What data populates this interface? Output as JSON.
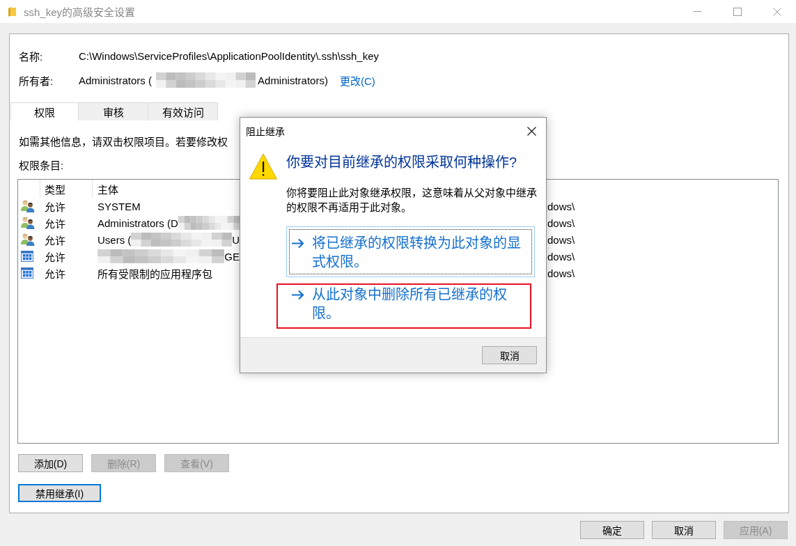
{
  "window": {
    "title": "ssh_key的高级安全设置"
  },
  "name_field": {
    "label": "名称:",
    "value": "C:\\Windows\\ServiceProfiles\\ApplicationPoolIdentity\\.ssh\\ssh_key"
  },
  "owner_field": {
    "label": "所有者:",
    "value": "Administrators (",
    "redacted": true,
    "value_tail": "Administrators)",
    "change_link": "更改(C)"
  },
  "tabs": [
    {
      "label": "权限",
      "selected": true
    },
    {
      "label": "审核",
      "selected": false
    },
    {
      "label": "有效访问",
      "selected": false
    }
  ],
  "info_text": "如需其他信息，请双击权限项目。若要修改权",
  "entries_label": "权限条目:",
  "permission_list": {
    "columns": [
      "类型",
      "主体"
    ],
    "rows": [
      {
        "kind": "group",
        "entry_type": "允许",
        "principal": "SYSTEM",
        "redacted": false,
        "column_3": "dows\\"
      },
      {
        "kind": "group",
        "entry_type": "允许",
        "principal": "Administrators (D",
        "redacted": true,
        "column_3": "dows\\"
      },
      {
        "kind": "group",
        "entry_type": "允许",
        "principal": "Users (",
        "redacted": true,
        "principal_tail": "U",
        "column_3": "dows\\"
      },
      {
        "kind": "package",
        "entry_type": "允许",
        "redacted": true,
        "principal_tail": "GE",
        "column_3": "dows\\"
      },
      {
        "kind": "package",
        "entry_type": "允许",
        "principal": "所有受限制的应用程序包",
        "redacted": false,
        "column_3": "dows\\"
      }
    ]
  },
  "list_buttons": [
    {
      "label": "添加(D)",
      "disabled": false
    },
    {
      "label": "删除(R)",
      "disabled": true
    },
    {
      "label": "查看(V)",
      "disabled": true
    }
  ],
  "inheritance_button": {
    "label": "禁用继承(I)",
    "focused": true
  },
  "footer_buttons": [
    {
      "label": "确定",
      "disabled": false
    },
    {
      "label": "取消",
      "disabled": false
    },
    {
      "label": "应用(A)",
      "disabled": true
    }
  ],
  "dialog": {
    "title": "阻止继承",
    "heading": "你要对目前继承的权限采取何种操作?",
    "description": "你将要阻止此对象继承权限，这意味着从父对象中继承的权限不再适用于此对象。",
    "options": [
      {
        "label": "将已继承的权限转换为此对象的显式权限。",
        "focused": true,
        "highlighted": false
      },
      {
        "label": "从此对象中删除所有已继承的权限。",
        "focused": false,
        "highlighted": true
      }
    ],
    "cancel_button": "取消"
  }
}
